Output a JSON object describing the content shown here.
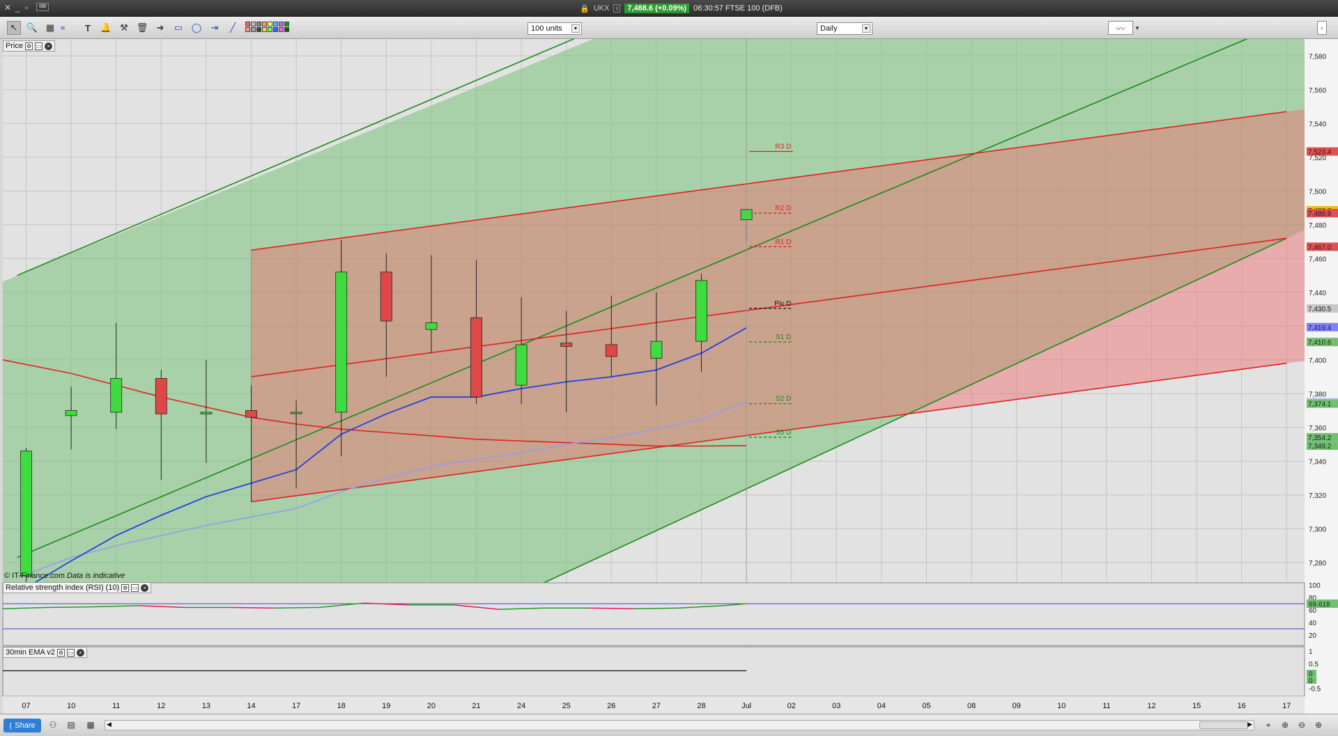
{
  "window": {
    "instrument": "UKX",
    "price_badge": "7,488.6 (+0.09%)",
    "time_and_name": "06:30:57 FTSE 100 (DFB)"
  },
  "toolbar": {
    "units_label": "100 units",
    "interval_label": "Daily",
    "colors": [
      "#ff6060",
      "#ff9090",
      "#c0c0c0",
      "#a0a0a0",
      "#808080",
      "#404040",
      "#ffa040",
      "#ffd040",
      "#ffff60",
      "#60ff60",
      "#40c0ff",
      "#4060ff",
      "#c060ff",
      "#ff60c0",
      "#00aa00",
      "#006600"
    ]
  },
  "panels": {
    "price_label": "Price",
    "rsi_label": "Relative strength index (RSI) (10)",
    "ema_label": "30min EMA v2"
  },
  "copyright": {
    "brand": "© IT-Finance.com",
    "note": "Data is indicative"
  },
  "statusbar": {
    "share_label": "Share"
  },
  "chart_data": {
    "type": "candlestick",
    "x_labels": [
      "07",
      "10",
      "11",
      "12",
      "13",
      "14",
      "17",
      "18",
      "19",
      "20",
      "21",
      "24",
      "25",
      "26",
      "27",
      "28",
      "Jul",
      "02",
      "03",
      "04",
      "05",
      "08",
      "09",
      "10",
      "11",
      "12",
      "15",
      "16",
      "17"
    ],
    "y_ticks": [
      "7,580",
      "7,560",
      "7,540",
      "7,520",
      "7,500",
      "7,480",
      "7,460",
      "7,440",
      "7,420",
      "7,400",
      "7,380",
      "7,360",
      "7,340",
      "7,320",
      "7,300",
      "7,280"
    ],
    "ylim": [
      7268,
      7590
    ],
    "candles": [
      {
        "o": 7272,
        "h": 7348,
        "l": 7262,
        "c": 7346
      },
      {
        "o": 7367,
        "h": 7384,
        "l": 7347,
        "c": 7370
      },
      {
        "o": 7369,
        "h": 7422,
        "l": 7359,
        "c": 7389
      },
      {
        "o": 7389,
        "h": 7394,
        "l": 7329,
        "c": 7368
      },
      {
        "o": 7368,
        "h": 7400,
        "l": 7339,
        "c": 7369
      },
      {
        "o": 7370,
        "h": 7385,
        "l": 7316,
        "c": 7366
      },
      {
        "o": 7369,
        "h": 7376,
        "l": 7324,
        "c": 7369
      },
      {
        "o": 7369,
        "h": 7471,
        "l": 7343,
        "c": 7452
      },
      {
        "o": 7452,
        "h": 7463,
        "l": 7390,
        "c": 7423
      },
      {
        "o": 7418,
        "h": 7462,
        "l": 7404,
        "c": 7422
      },
      {
        "o": 7425,
        "h": 7459,
        "l": 7374,
        "c": 7378
      },
      {
        "o": 7385,
        "h": 7437,
        "l": 7374,
        "c": 7409
      },
      {
        "o": 7410,
        "h": 7429,
        "l": 7369,
        "c": 7408
      },
      {
        "o": 7409,
        "h": 7438,
        "l": 7390,
        "c": 7402
      },
      {
        "o": 7401,
        "h": 7440,
        "l": 7373,
        "c": 7411
      },
      {
        "o": 7411,
        "h": 7451,
        "l": 7393,
        "c": 7447
      },
      {
        "o": 7483,
        "h": 7490,
        "l": 7470,
        "c": 7489
      }
    ],
    "ema_fast": [
      7265,
      7281,
      7296,
      7308,
      7319,
      7327,
      7335,
      7356,
      7368,
      7378,
      7378,
      7383,
      7387,
      7390,
      7394,
      7404,
      7419
    ],
    "ema_slow": [
      7273,
      7283,
      7290,
      7296,
      7302,
      7307,
      7312,
      7322,
      7330,
      7337,
      7341,
      7345,
      7350,
      7354,
      7359,
      7365,
      7375
    ],
    "red_sma": [
      7400,
      7392,
      7385,
      7378,
      7372,
      7366,
      7362,
      7359,
      7357,
      7355,
      7353,
      7352,
      7351,
      7350,
      7349,
      7349,
      7349.2
    ],
    "pivots": [
      {
        "name": "R3 D",
        "value": 7523.4
      },
      {
        "name": "R2 D",
        "value": 7486.9
      },
      {
        "name": "R1 D",
        "value": 7467.0
      },
      {
        "name": "Piv D",
        "value": 7430.5
      },
      {
        "name": "S1 D",
        "value": 7410.6
      },
      {
        "name": "S2 D",
        "value": 7374.1
      },
      {
        "name": "S3 D",
        "value": 7354.2
      }
    ],
    "right_labels": [
      {
        "value": 7523.4,
        "text": "7,523.4",
        "color": "#e05050"
      },
      {
        "value": 7488.6,
        "text": "7,488.6",
        "color": "#f0c000"
      },
      {
        "value": 7486.9,
        "text": "7,486.9",
        "color": "#e05050"
      },
      {
        "value": 7467.0,
        "text": "7,467.0",
        "color": "#e05050"
      },
      {
        "value": 7430.5,
        "text": "7,430.5",
        "color": "#c8c8c8"
      },
      {
        "value": 7419.4,
        "text": "7,419.4",
        "color": "#8080ff"
      },
      {
        "value": 7410.6,
        "text": "7,410.6",
        "color": "#70c070"
      },
      {
        "value": 7374.9,
        "text": "7,374.9",
        "color": "#c0c0e8"
      },
      {
        "value": 7374.1,
        "text": "7,374.1",
        "color": "#70c070"
      },
      {
        "value": 7354.2,
        "text": "7,354.2",
        "color": "#70c070"
      },
      {
        "value": 7349.2,
        "text": "7,349.2",
        "color": "#70c070"
      }
    ],
    "green_channel": {
      "top": [
        [
          -0.2,
          7450
        ],
        [
          12.6,
          7595
        ]
      ],
      "mid": [
        [
          -0.2,
          7283
        ],
        [
          28,
          7600
        ]
      ],
      "bottom": [
        [
          11.5,
          7268
        ],
        [
          28,
          7472
        ]
      ]
    },
    "red_channel": {
      "top": [
        [
          5,
          7465
        ],
        [
          28,
          7547
        ]
      ],
      "mid": [
        [
          5,
          7390
        ],
        [
          28,
          7472
        ]
      ],
      "bottom": [
        [
          5,
          7316
        ],
        [
          28,
          7398
        ]
      ]
    },
    "rsi": {
      "ticks": [
        "100",
        "80",
        "60",
        "40",
        "20"
      ],
      "last_value": "69.618",
      "values": [
        62,
        64,
        65,
        67,
        64,
        64,
        63,
        64,
        71,
        68,
        68,
        61,
        63,
        63,
        62,
        63,
        67,
        70
      ]
    },
    "ema_panel": {
      "ticks": [
        "1",
        "0.5",
        "0",
        "-0.5"
      ],
      "values": [
        "0",
        "0"
      ]
    }
  }
}
